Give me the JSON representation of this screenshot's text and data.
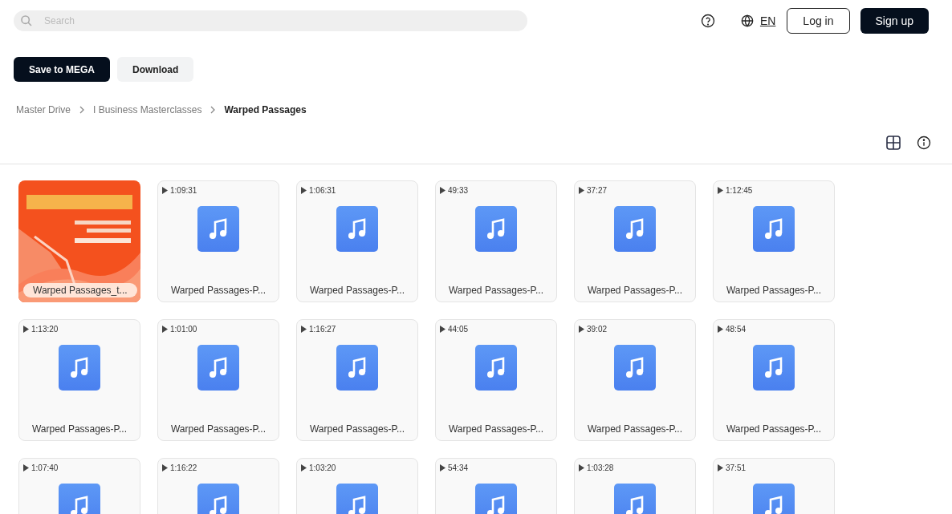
{
  "header": {
    "search": {
      "placeholder": "Search"
    },
    "language": "EN",
    "login": "Log in",
    "signup": "Sign up"
  },
  "actions": [
    "Save to MEGA",
    "Download"
  ],
  "breadcrumbs": [
    {
      "label": "Master Drive",
      "current": false
    },
    {
      "label": "I Business Masterclasses",
      "current": false
    },
    {
      "label": "Warped Passages",
      "current": true
    }
  ],
  "files": [
    {
      "name": "Warped Passages_t..."
    },
    {
      "kind": "audio",
      "duration": "1:09:31",
      "name": "Warped Passages-P..."
    },
    {
      "kind": "audio",
      "duration": "1:06:31",
      "name": "Warped Passages-P..."
    },
    {
      "kind": "audio",
      "duration": "49:33",
      "name": "Warped Passages-P..."
    },
    {
      "kind": "audio",
      "duration": "37:27",
      "name": "Warped Passages-P..."
    },
    {
      "kind": "audio",
      "duration": "1:12:45",
      "name": "Warped Passages-P..."
    },
    {
      "kind": "audio",
      "duration": "1:13:20",
      "name": "Warped Passages-P..."
    },
    {
      "kind": "audio",
      "duration": "1:01:00",
      "name": "Warped Passages-P..."
    },
    {
      "kind": "audio",
      "duration": "1:16:27",
      "name": "Warped Passages-P..."
    },
    {
      "kind": "audio",
      "duration": "44:05",
      "name": "Warped Passages-P..."
    },
    {
      "kind": "audio",
      "duration": "39:02",
      "name": "Warped Passages-P..."
    },
    {
      "kind": "audio",
      "duration": "48:54",
      "name": "Warped Passages-P..."
    },
    {
      "kind": "audio",
      "duration": "1:07:40"
    },
    {
      "kind": "audio",
      "duration": "1:16:22"
    },
    {
      "kind": "audio",
      "duration": "1:03:20"
    },
    {
      "kind": "audio",
      "duration": "54:34"
    },
    {
      "kind": "audio",
      "duration": "1:03:28"
    },
    {
      "kind": "audio",
      "duration": "37:51"
    }
  ]
}
